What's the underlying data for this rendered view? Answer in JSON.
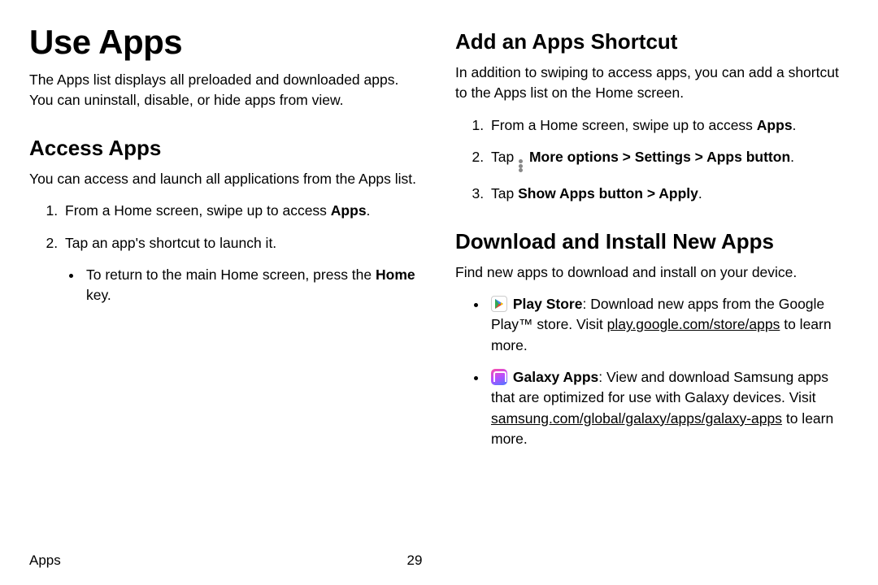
{
  "left": {
    "title": "Use Apps",
    "intro": "The Apps list displays all preloaded and downloaded apps. You can uninstall, disable, or hide apps from view.",
    "access": {
      "heading": "Access Apps",
      "intro": "You can access and launch all applications from the Apps list.",
      "step1_a": "From a Home screen, swipe up to access ",
      "step1_b": "Apps",
      "step1_c": ".",
      "step2": "Tap an app's shortcut to launch it.",
      "step2_sub_a": "To return to the main Home screen, press the ",
      "step2_sub_b": "Home",
      "step2_sub_c": " key."
    }
  },
  "right": {
    "shortcut": {
      "heading": "Add an Apps Shortcut",
      "intro": "In addition to swiping to access apps, you can add a shortcut to the Apps list on the Home screen.",
      "step1_a": "From a Home screen, swipe up to access ",
      "step1_b": "Apps",
      "step1_c": ".",
      "step2_a": "Tap ",
      "step2_b": "More options",
      "step2_c": " > ",
      "step2_d": "Settings",
      "step2_e": " > ",
      "step2_f": "Apps button",
      "step2_g": ".",
      "step3_a": "Tap ",
      "step3_b": "Show Apps button",
      "step3_c": " > ",
      "step3_d": "Apply",
      "step3_e": "."
    },
    "download": {
      "heading": "Download and Install New Apps",
      "intro": "Find new apps to download and install on your device.",
      "ps_name": "Play Store",
      "ps_body1": ": Download new apps from the Google Play™ store. Visit ",
      "ps_link": "play.google.com/store/apps",
      "ps_body2": " to learn more.",
      "ga_name": "Galaxy Apps",
      "ga_body1": ": View and download Samsung apps that are optimized for use with Galaxy devices. Visit ",
      "ga_link": "samsung.com/global/galaxy/apps/galaxy-apps",
      "ga_body2": " to learn more."
    }
  },
  "footer": {
    "section": "Apps",
    "page": "29"
  }
}
